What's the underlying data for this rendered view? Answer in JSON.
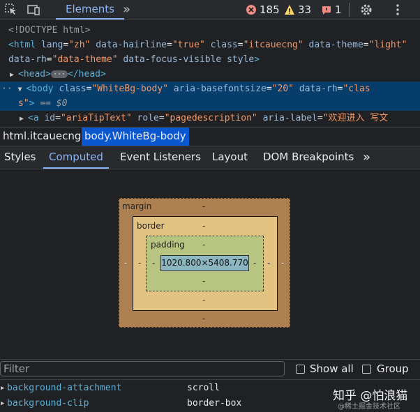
{
  "toolbar": {
    "inspect_icon": "cursor-select-icon",
    "device_icon": "device-toggle-icon",
    "tab_elements": "Elements",
    "more_tabs": "»",
    "errors": "185",
    "warnings": "33",
    "issues": "1",
    "settings_icon": "gear-icon",
    "menu_icon": "kebab-menu-icon"
  },
  "dom": {
    "doctype": "<!DOCTYPE html>",
    "html_line1": {
      "tag_open": "<html",
      "a1": "lang",
      "v1": "\"zh\"",
      "a2": "data-hairline",
      "v2": "\"true\"",
      "a3": "class",
      "v3": "\"itcauecng\"",
      "a4": "data-theme",
      "v4": "\"light\""
    },
    "html_line2": {
      "a1": "data-rh",
      "v1": "\"data-theme\"",
      "a2": "data-focus-visible",
      "a3": "style",
      "close": ">"
    },
    "head": {
      "open": "<head>",
      "ellipsis": "···",
      "close": "</head>"
    },
    "body_line1": {
      "dots": "··",
      "tag_open": "<body",
      "a1": "class",
      "v1": "\"WhiteBg-body\"",
      "a2": "aria-basefontsize",
      "v2": "\"20\"",
      "a3": "data-rh",
      "v3": "\"clas"
    },
    "body_line2": {
      "v_cont": "s\"",
      "close": ">",
      "eq": "== $0"
    },
    "a_line": {
      "tag_open": "<a",
      "a1": "id",
      "v1": "\"ariaTipText\"",
      "a2": "role",
      "v2": "\"pagedescription\"",
      "a3": "aria-label",
      "v3": "\"欢迎进入 写文"
    }
  },
  "breadcrumb": {
    "item1": "html.itcauecng",
    "item2": "body.WhiteBg-body"
  },
  "subtabs": {
    "styles": "Styles",
    "computed": "Computed",
    "event_listeners": "Event Listeners",
    "layout": "Layout",
    "dom_breakpoints": "DOM Breakpoints",
    "more": "»"
  },
  "box_model": {
    "margin_label": "margin",
    "border_label": "border",
    "padding_label": "padding",
    "content": "1020.800×5408.770",
    "dash": "-",
    "margin_value": "-"
  },
  "filter": {
    "placeholder": "Filter",
    "show_all": "Show all",
    "group": "Group"
  },
  "properties": [
    {
      "name": "background-attachment",
      "value": "scroll"
    },
    {
      "name": "background-clip",
      "value": "border-box"
    }
  ],
  "watermark": {
    "main": "知乎 @怕浪猫",
    "sub": "@稀土掘金技术社区"
  },
  "colors": {
    "accent": "#8ab4f8",
    "selection": "#073d6b",
    "error": "#f28b82",
    "warning": "#fdd663",
    "margin": "#ad8052",
    "border": "#e3c381",
    "padding": "#b7c580",
    "content": "#8cb6c0"
  }
}
